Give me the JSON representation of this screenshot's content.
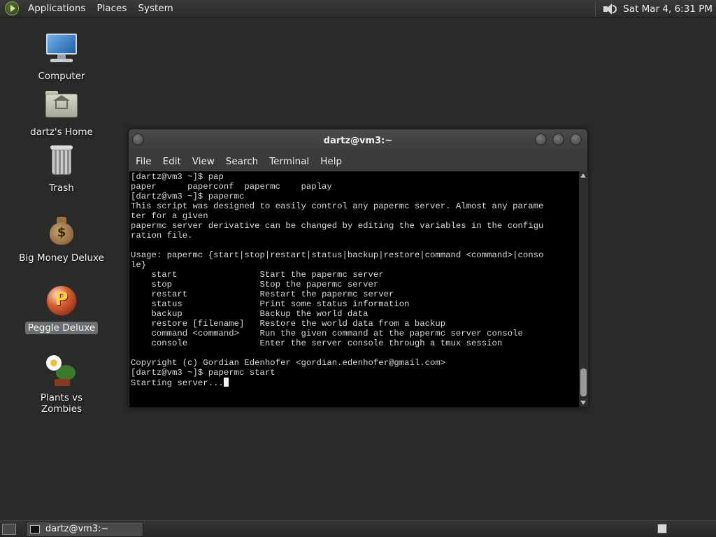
{
  "top_panel": {
    "menus": [
      "Applications",
      "Places",
      "System"
    ],
    "clock": "Sat Mar  4,  6:31 PM"
  },
  "desktop_icons": [
    {
      "label": "Computer",
      "icon": "computer-icon"
    },
    {
      "label": "dartz's Home",
      "icon": "home-folder-icon"
    },
    {
      "label": "Trash",
      "icon": "trash-icon"
    },
    {
      "label": "Big Money Deluxe",
      "icon": "money-bag-icon"
    },
    {
      "label": "Peggle Deluxe",
      "icon": "peggle-icon",
      "selected": true
    },
    {
      "label": "Plants vs Zombies",
      "icon": "plants-icon"
    }
  ],
  "terminal": {
    "title": "dartz@vm3:~",
    "menus": [
      "File",
      "Edit",
      "View",
      "Search",
      "Terminal",
      "Help"
    ],
    "lines": [
      "[dartz@vm3 ~]$ pap",
      "paper      paperconf  papermc    paplay",
      "[dartz@vm3 ~]$ papermc",
      "This script was designed to easily control any papermc server. Almost any parame",
      "ter for a given",
      "papermc server derivative can be changed by editing the variables in the configu",
      "ration file.",
      "",
      "Usage: papermc {start|stop|restart|status|backup|restore|command <command>|conso",
      "le}",
      "    start                Start the papermc server",
      "    stop                 Stop the papermc server",
      "    restart              Restart the papermc server",
      "    status               Print some status information",
      "    backup               Backup the world data",
      "    restore [filename]   Restore the world data from a backup",
      "    command <command>    Run the given command at the papermc server console",
      "    console              Enter the server console through a tmux session",
      "",
      "Copyright (c) Gordian Edenhofer <gordian.edenhofer@gmail.com>",
      "[dartz@vm3 ~]$ papermc start",
      "Starting server..."
    ]
  },
  "taskbar": {
    "tasks": [
      {
        "label": "dartz@vm3:~",
        "icon": "terminal-icon"
      }
    ]
  }
}
